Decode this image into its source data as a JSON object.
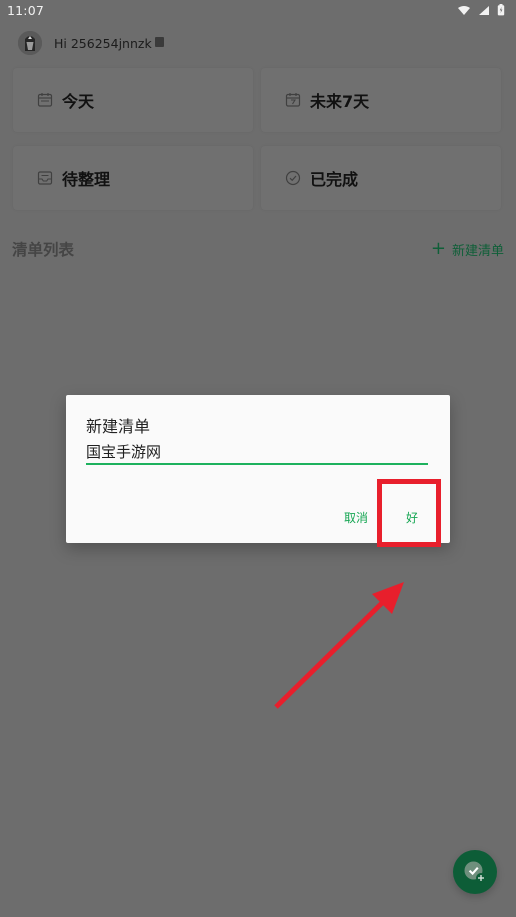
{
  "status_bar": {
    "time": "11:07"
  },
  "header": {
    "greeting": "Hi 256254jnnzk"
  },
  "cards": {
    "today": "今天",
    "next7": "未来7天",
    "inbox": "待整理",
    "done": "已完成"
  },
  "lists_section": {
    "title": "清单列表",
    "new_list": "新建清单"
  },
  "dialog": {
    "title": "新建清单",
    "input_value": "国宝手游网",
    "cancel": "取消",
    "ok": "好"
  },
  "colors": {
    "accent": "#1db15d",
    "overlay": "#6d6d6d",
    "highlight": "#e81f2c",
    "fab": "#0d5d37"
  },
  "icons": {
    "wifi": "wifi-icon",
    "signal": "signal-icon",
    "battery": "battery-icon",
    "today": "calendar-icon",
    "next7": "calendar-7-icon",
    "inbox": "inbox-icon",
    "done": "check-circle-icon",
    "fab": "add-task-icon"
  }
}
